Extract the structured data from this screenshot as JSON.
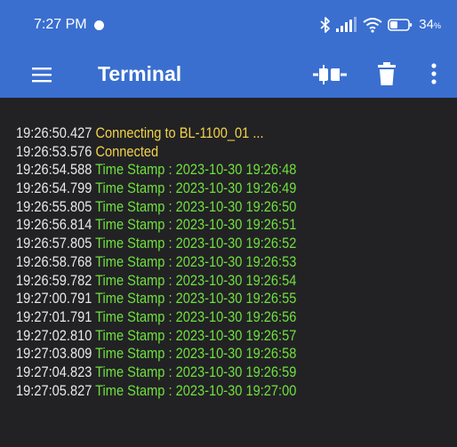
{
  "status_bar": {
    "time": "7:27 PM",
    "battery": "34",
    "battery_unit": "%",
    "icons": [
      "bluetooth-icon",
      "signal-icon",
      "wifi-icon",
      "battery-icon"
    ]
  },
  "app_bar": {
    "title": "Terminal",
    "icons": [
      "menu-icon",
      "connect-icon",
      "trash-icon",
      "more-vert-icon"
    ]
  },
  "colors": {
    "app_bar": "#3a6fd0",
    "terminal_bg": "#222224",
    "timestamp_text": "#e8e8e8",
    "status_text": "#f2d24a",
    "data_text": "#6fe03e"
  },
  "terminal": {
    "lines": [
      {
        "time": "19:26:50.427",
        "text": "Connecting to BL-1100_01 ...",
        "kind": "status"
      },
      {
        "time": "19:26:53.576",
        "text": "Connected",
        "kind": "status"
      },
      {
        "time": "19:26:54.588",
        "text": "Time Stamp : 2023-10-30 19:26:48",
        "kind": "data"
      },
      {
        "time": "19:26:54.799",
        "text": "Time Stamp : 2023-10-30 19:26:49",
        "kind": "data"
      },
      {
        "time": "19:26:55.805",
        "text": "Time Stamp : 2023-10-30 19:26:50",
        "kind": "data"
      },
      {
        "time": "19:26:56.814",
        "text": "Time Stamp : 2023-10-30 19:26:51",
        "kind": "data"
      },
      {
        "time": "19:26:57.805",
        "text": "Time Stamp : 2023-10-30 19:26:52",
        "kind": "data"
      },
      {
        "time": "19:26:58.768",
        "text": "Time Stamp : 2023-10-30 19:26:53",
        "kind": "data"
      },
      {
        "time": "19:26:59.782",
        "text": "Time Stamp : 2023-10-30 19:26:54",
        "kind": "data"
      },
      {
        "time": "19:27:00.791",
        "text": "Time Stamp : 2023-10-30 19:26:55",
        "kind": "data"
      },
      {
        "time": "19:27:01.791",
        "text": "Time Stamp : 2023-10-30 19:26:56",
        "kind": "data"
      },
      {
        "time": "19:27:02.810",
        "text": "Time Stamp : 2023-10-30 19:26:57",
        "kind": "data"
      },
      {
        "time": "19:27:03.809",
        "text": "Time Stamp : 2023-10-30 19:26:58",
        "kind": "data"
      },
      {
        "time": "19:27:04.823",
        "text": "Time Stamp : 2023-10-30 19:26:59",
        "kind": "data"
      },
      {
        "time": "19:27:05.827",
        "text": "Time Stamp : 2023-10-30 19:27:00",
        "kind": "data"
      }
    ]
  }
}
